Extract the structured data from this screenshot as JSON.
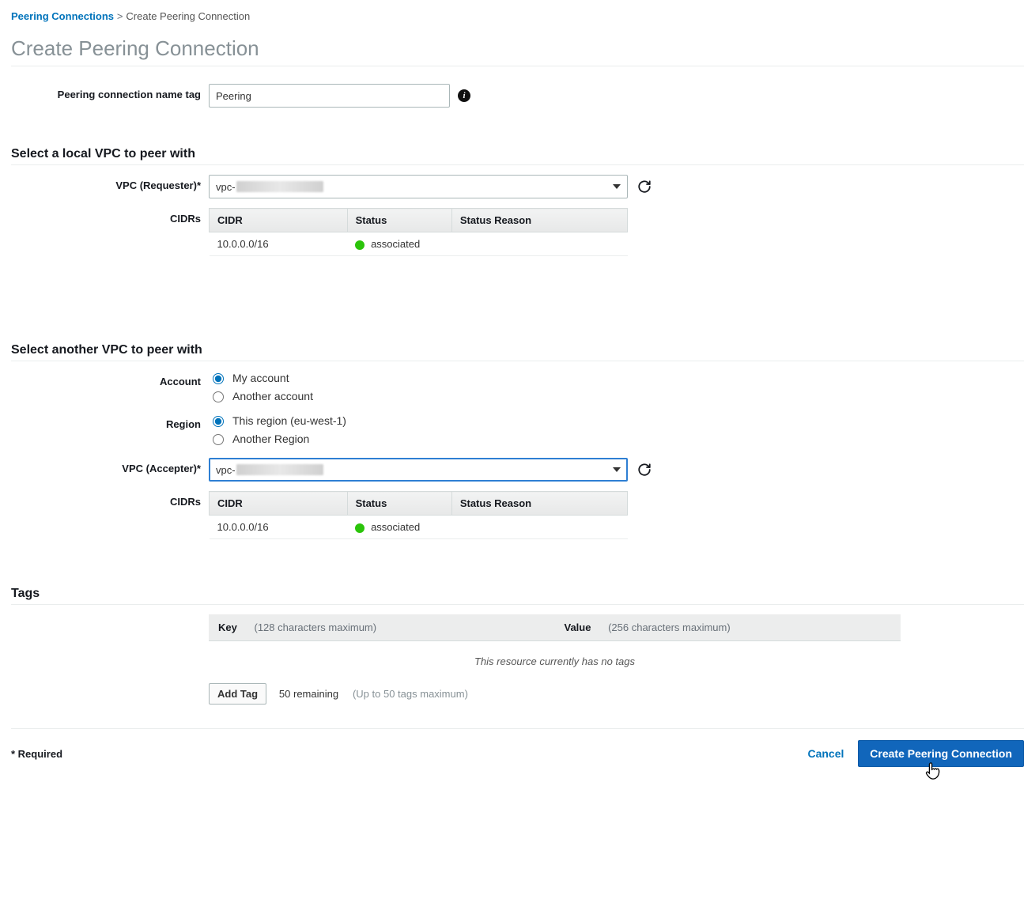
{
  "breadcrumb": {
    "parent": "Peering Connections",
    "sep": ">",
    "current": "Create Peering Connection"
  },
  "page_title": "Create Peering Connection",
  "name_tag": {
    "label": "Peering connection name tag",
    "value": "Peering"
  },
  "local_vpc": {
    "section_title": "Select a local VPC to peer with",
    "requester_label": "VPC (Requester)*",
    "requester_value_prefix": "vpc-",
    "cidrs_label": "CIDRs",
    "table": {
      "headers": {
        "cidr": "CIDR",
        "status": "Status",
        "reason": "Status Reason"
      },
      "rows": [
        {
          "cidr": "10.0.0.0/16",
          "status": "associated",
          "reason": ""
        }
      ]
    }
  },
  "another_vpc": {
    "section_title": "Select another VPC to peer with",
    "account_label": "Account",
    "account_options": {
      "my": "My account",
      "other": "Another account"
    },
    "region_label": "Region",
    "region_options": {
      "this": "This region (eu-west-1)",
      "other": "Another Region"
    },
    "accepter_label": "VPC (Accepter)*",
    "accepter_value_prefix": "vpc-",
    "cidrs_label": "CIDRs",
    "table": {
      "headers": {
        "cidr": "CIDR",
        "status": "Status",
        "reason": "Status Reason"
      },
      "rows": [
        {
          "cidr": "10.0.0.0/16",
          "status": "associated",
          "reason": ""
        }
      ]
    }
  },
  "tags": {
    "section_title": "Tags",
    "key_label": "Key",
    "key_hint": "(128 characters maximum)",
    "value_label": "Value",
    "value_hint": "(256 characters maximum)",
    "empty_text": "This resource currently has no tags",
    "add_button": "Add Tag",
    "remaining": "50 remaining",
    "max_hint": "(Up to 50 tags maximum)"
  },
  "footer": {
    "required": "* Required",
    "cancel": "Cancel",
    "create": "Create Peering Connection"
  }
}
